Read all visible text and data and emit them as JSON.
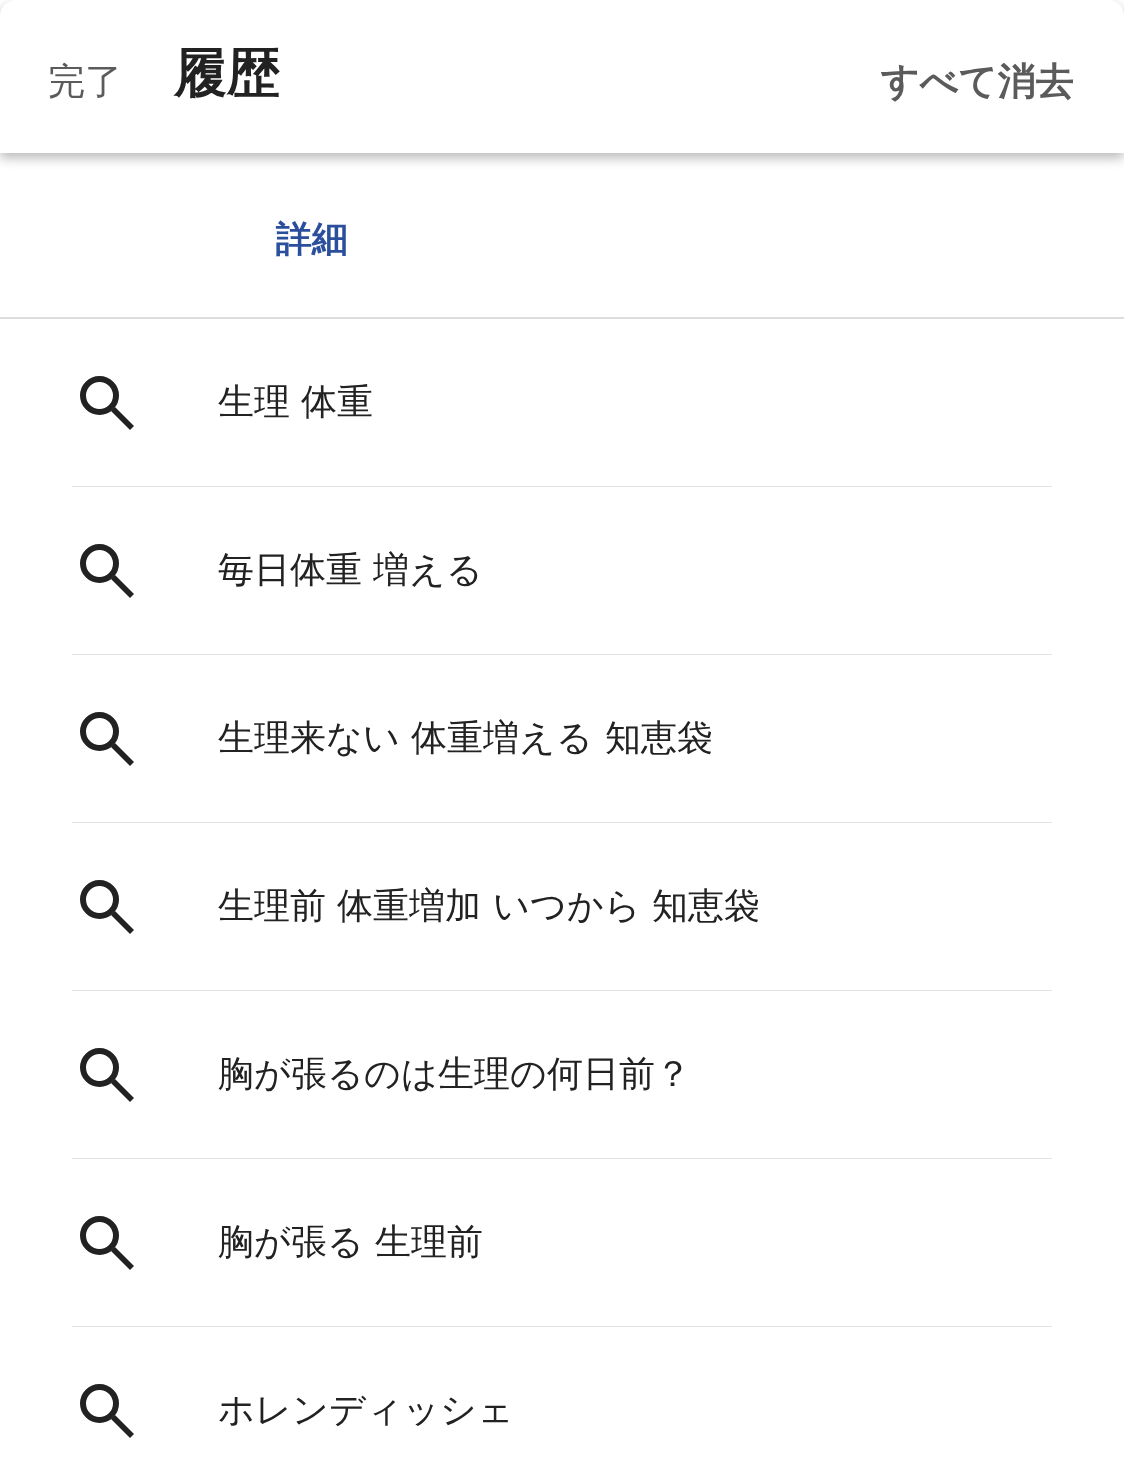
{
  "header": {
    "done_button": "完了",
    "title": "履歴",
    "clear_all_button": "すべて消去"
  },
  "details_link": "詳細",
  "history": [
    {
      "query": "生理 体重"
    },
    {
      "query": "毎日体重 増える"
    },
    {
      "query": "生理来ない 体重増える 知恵袋"
    },
    {
      "query": "生理前 体重増加 いつから 知恵袋"
    },
    {
      "query": "胸が張るのは生理の何日前？"
    },
    {
      "query": "胸が張る 生理前"
    },
    {
      "query": "ホレンディッシェ"
    }
  ]
}
